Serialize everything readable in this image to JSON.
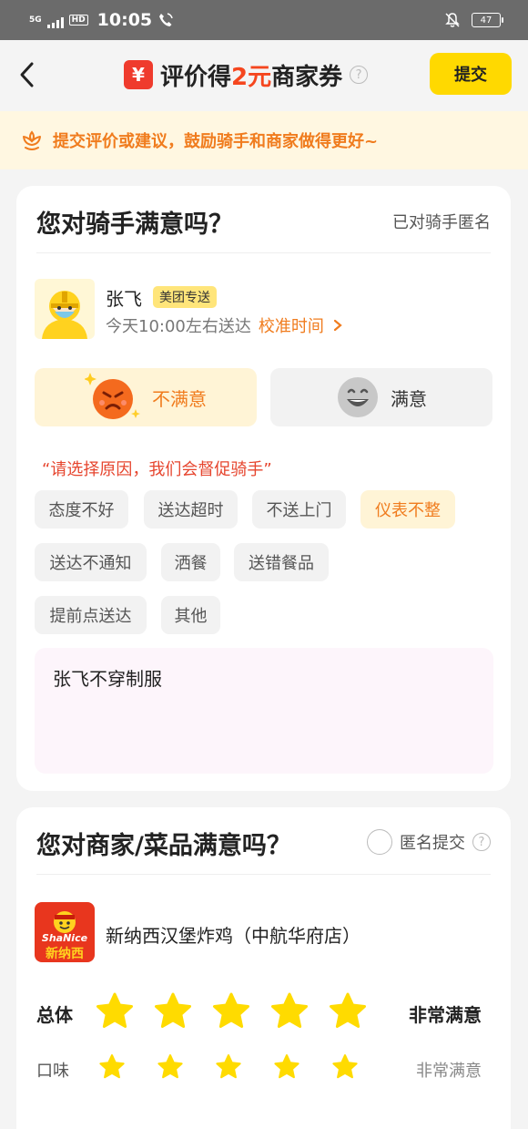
{
  "status_bar": {
    "network": "5G",
    "hd": "HD",
    "time": "10:05",
    "battery": "47"
  },
  "header": {
    "title_prefix": "评价得",
    "title_highlight": "2元",
    "title_suffix": "商家券",
    "yen_symbol": "¥",
    "submit_label": "提交"
  },
  "tip": {
    "text": "提交评价或建议，鼓励骑手和商家做得更好~"
  },
  "rider_section": {
    "title": "您对骑手满意吗？",
    "anonymous_text": "已对骑手匿名",
    "rider_name": "张飞",
    "rider_tag": "美团专送",
    "eta": "今天10:00左右送达",
    "calibrate_link": "校准时间",
    "mood_bad_label": "不满意",
    "mood_good_label": "满意",
    "mood_selected": "不满意",
    "reason_prompt": "“请选择原因，我们会督促骑手”",
    "reasons": [
      "态度不好",
      "送达超时",
      "不送上门",
      "仪表不整",
      "送达不通知",
      "洒餐",
      "送错餐品",
      "提前点送达",
      "其他"
    ],
    "selected_reason": "仪表不整",
    "comment": "张飞不穿制服"
  },
  "merchant_section": {
    "title": "您对商家/菜品满意吗？",
    "anonymous_label": "匿名提交",
    "shop_name": "新纳西汉堡炸鸡（中航华府店）",
    "shop_logo_text": "ShaNice",
    "shop_logo_cn": "新纳西",
    "ratings": [
      {
        "label": "总体",
        "stars": 5,
        "text": "非常满意"
      },
      {
        "label": "口味",
        "stars": 5,
        "text": "非常满意"
      }
    ]
  },
  "colors": {
    "accent_yellow": "#ffd900",
    "orange": "#f07c1e",
    "red": "#f5461e",
    "star": "#ffdb00"
  }
}
